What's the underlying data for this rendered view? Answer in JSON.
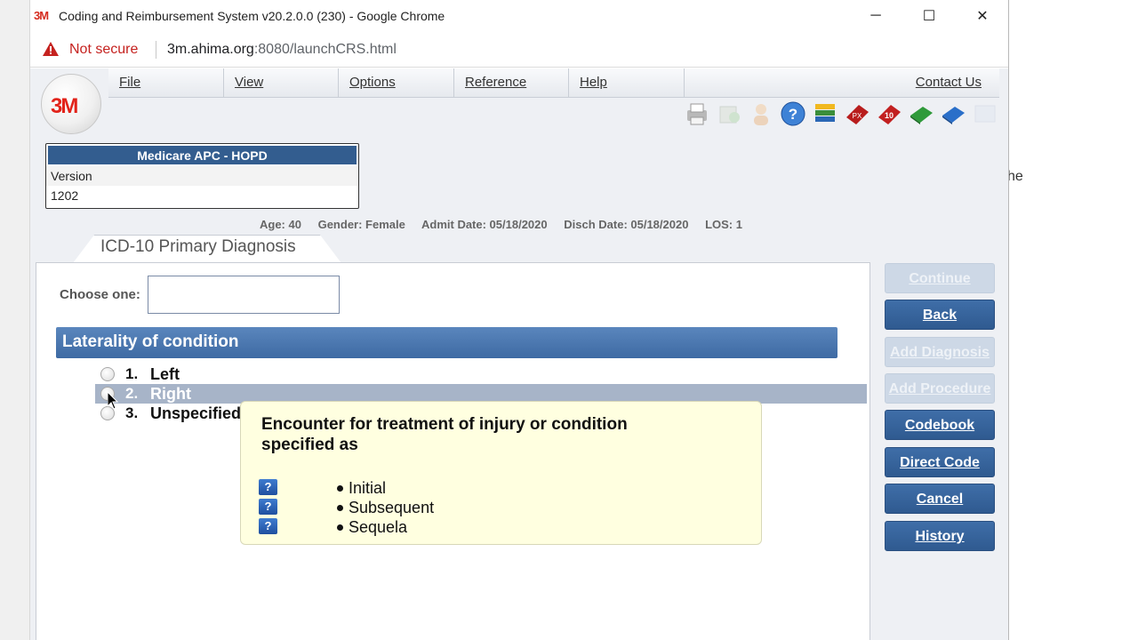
{
  "window": {
    "logo": "3M",
    "title": "Coding and Reimbursement System v20.2.0.0 (230) - Google Chrome",
    "minimize": "─",
    "maximize": "☐",
    "close": "✕"
  },
  "address_bar": {
    "security_label": "Not secure",
    "url_host": "3m.ahima.org",
    "url_rest": ":8080/launchCRS.html"
  },
  "app": {
    "logo": "3M",
    "menu": [
      "File",
      "View",
      "Options",
      "Reference",
      "Help"
    ],
    "contact": "Contact Us",
    "toolbar_icons": [
      "printer-icon",
      "grouper-icon",
      "person-icon",
      "help-icon",
      "books-icon",
      "px-book-icon",
      "icd10-book-icon",
      "green-book-icon",
      "blue-book-icon",
      "disabled-icon"
    ],
    "grouper": {
      "name": "Medicare APC - HOPD",
      "version_label": "Version",
      "version": "1202"
    },
    "patient": {
      "age": "Age: 40",
      "gender": "Gender: Female",
      "admit": "Admit Date: 05/18/2020",
      "disch": "Disch Date: 05/18/2020",
      "los": "LOS: 1"
    },
    "tab_label": "ICD-10 Primary Diagnosis",
    "choose_label": "Choose one:",
    "choose_value": "",
    "section_title": "Laterality of condition",
    "options": [
      {
        "num": "1.",
        "text": "Left"
      },
      {
        "num": "2.",
        "text": "Right"
      },
      {
        "num": "3.",
        "text": "Unspecified"
      }
    ],
    "tooltip": {
      "title": "Encounter for treatment of injury or condition specified as",
      "items": [
        "Initial",
        "Subsequent",
        "Sequela"
      ],
      "help_glyph": "?"
    },
    "buttons": {
      "continue": "Continue",
      "back": "Back",
      "add_diagnosis": "Add Diagnosis",
      "add_procedure": "Add Procedure",
      "codebook": "Codebook",
      "direct_code": "Direct Code",
      "cancel": "Cancel",
      "history": "History"
    }
  },
  "background_text": "he",
  "colors": {
    "accent": "#335d8f",
    "highlight_row": "#a7b4c8",
    "tooltip_bg": "#ffffe0",
    "warning": "#c5221f"
  }
}
